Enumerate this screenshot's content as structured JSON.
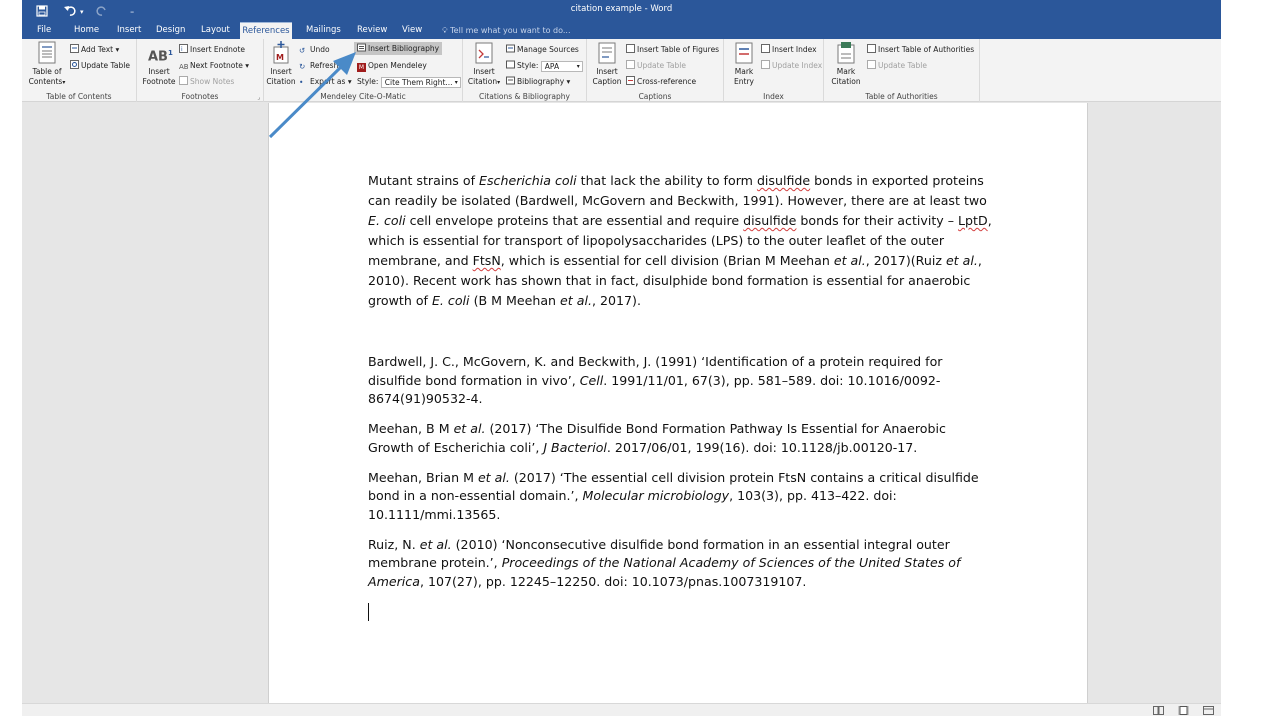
{
  "window": {
    "title": "citation example - Word"
  },
  "tabs": [
    "File",
    "Home",
    "Insert",
    "Design",
    "Layout",
    "References",
    "Mailings",
    "Review",
    "View"
  ],
  "tell_me": "Tell me what you want to do...",
  "ribbon": {
    "toc": {
      "big": "Table of\nContents",
      "add_text": "Add Text",
      "update_table": "Update Table",
      "label": "Table of Contents"
    },
    "footnotes": {
      "big": "Insert\nFootnote",
      "insert_endnote": "Insert Endnote",
      "next_footnote": "Next Footnote",
      "show_notes": "Show Notes",
      "label": "Footnotes"
    },
    "mendeley": {
      "big": "Insert\nCitation",
      "undo": "Undo",
      "refresh": "Refresh",
      "export_as": "Export as",
      "insert_bibliography": "Insert Bibliography",
      "open_mendeley": "Open Mendeley",
      "style_label": "Style:",
      "style_value": "Cite Them Right...",
      "label": "Mendeley Cite-O-Matic"
    },
    "citations": {
      "big": "Insert\nCitation",
      "manage_sources": "Manage Sources",
      "style_label": "Style:",
      "style_value": "APA",
      "bibliography": "Bibliography",
      "label": "Citations & Bibliography"
    },
    "captions": {
      "big": "Insert\nCaption",
      "insert_table_of_figures": "Insert Table of Figures",
      "update_table": "Update Table",
      "cross_reference": "Cross-reference",
      "label": "Captions"
    },
    "index": {
      "big": "Mark\nEntry",
      "insert_index": "Insert Index",
      "update_index": "Update Index",
      "label": "Index"
    },
    "authorities": {
      "big": "Mark\nCitation",
      "insert_table_of_authorities": "Insert Table of Authorities",
      "update_table": "Update Table",
      "label": "Table of Authorities"
    }
  },
  "document": {
    "p1": "Mutant strains of ",
    "p2": "Escherichia coli",
    "p3": " that lack the ability to form ",
    "p4": "disulfide",
    "p5": " bonds in exported proteins can readily be isolated (Bardwell, McGovern and Beckwith, 1991). However, there are at least two ",
    "p6": "E. coli",
    "p7": " cell envelope proteins that are essential and require ",
    "p8": "disulfide",
    "p9": " bonds for their activity – ",
    "p10": "LptD",
    "p11": ", which is essential for transport of lipopolysaccharides (LPS) to the outer leaflet of the outer membrane, and ",
    "p12": "FtsN",
    "p13": ", which is essential for cell division (Brian M Meehan ",
    "p14": "et al.",
    "p15": ", 2017)(Ruiz ",
    "p16": "et al.",
    "p17": ", 2010).  Recent work has shown that in fact, disulphide bond formation is essential for anaerobic growth of ",
    "p18": "E. coli",
    "p19": " (B M Meehan ",
    "p20": "et al.",
    "p21": ", 2017).",
    "refs": [
      {
        "a": "Bardwell, J. C., McGovern, K. and Beckwith, J. (1991) ‘Identification of a protein required for disulfide bond formation in vivo’, ",
        "b": "Cell",
        "c": ". 1991/11/01, 67(3), pp. 581–589. doi: 10.1016/0092-8674(91)90532-4."
      },
      {
        "a": "Meehan, B M ",
        "b": "et al.",
        "c": " (2017) ‘The Disulfide Bond Formation Pathway Is Essential for Anaerobic Growth of Escherichia coli’, ",
        "d": "J Bacteriol",
        "e": ". 2017/06/01, 199(16). doi: 10.1128/jb.00120-17."
      },
      {
        "a": "Meehan, Brian M ",
        "b": "et al.",
        "c": " (2017) ‘The essential cell division protein FtsN contains a critical disulfide bond in a  non-essential domain.’, ",
        "d": "Molecular microbiology",
        "e": ", 103(3), pp. 413–422. doi: 10.1111/mmi.13565."
      },
      {
        "a": "Ruiz, N. ",
        "b": "et al.",
        "c": " (2010) ‘Nonconsecutive disulfide bond formation in an essential integral outer membrane  protein.’, ",
        "d": "Proceedings of the National Academy of Sciences of the United States of America",
        "e": ", 107(27), pp. 12245–12250. doi: 10.1073/pnas.1007319107."
      }
    ]
  },
  "colors": {
    "accent": "#2b579a",
    "arrow": "#4a8ac8"
  }
}
